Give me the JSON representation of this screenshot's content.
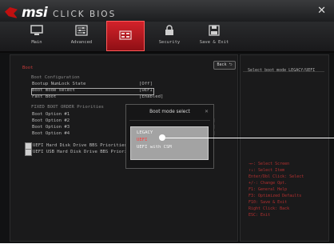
{
  "brand": {
    "name": "msi",
    "product": "CLICK BIOS"
  },
  "window": {
    "close": "✕"
  },
  "nav": {
    "tabs": [
      {
        "label": "Main",
        "icon": "monitor-icon"
      },
      {
        "label": "Advanced",
        "icon": "sliders-icon"
      },
      {
        "label": "",
        "icon": "chip-icon",
        "active": true
      },
      {
        "label": "Security",
        "icon": "lock-icon"
      },
      {
        "label": "Save & Exit",
        "icon": "save-icon"
      }
    ]
  },
  "main": {
    "section": "Boot",
    "back_label": "Back",
    "config_heading": "Boot Configuration",
    "rows": [
      {
        "label": "Bootup NumLock State",
        "value": "[Off]"
      },
      {
        "label": "Boot mode select",
        "value": "[UEFI]"
      },
      {
        "label": "Fast Boot",
        "value": "[Enabled]"
      }
    ],
    "fixed_heading": "FIXED BOOT ORDER Priorities",
    "boot_options": [
      {
        "label": "Boot Option #1",
        "value": "]"
      },
      {
        "label": "Boot Option #2",
        "value": "]"
      },
      {
        "label": "Boot Option #3",
        "value": "]"
      },
      {
        "label": "Boot Option #4",
        "value": "]"
      }
    ],
    "links": [
      "UEFI Hard Disk Drive BBS Priorities",
      "UEFI USB Hard Disk Drive BBS Priorit"
    ]
  },
  "dialog": {
    "title": "Boot mode select",
    "close": "✕",
    "options": [
      "LEGACY",
      "UEFI",
      "UEFI with CSM"
    ],
    "selected": "UEFI"
  },
  "help": {
    "text": "Select boot mode LEGACY/UEFI",
    "keys": [
      "→←: Select Screen",
      "↑↓: Select Item",
      "Enter/Dbl Click: Select",
      "+/-: Change Opt.",
      "F1: General Help",
      "F3: Optimized Defaults",
      "F10: Save & Exit",
      "Right Click: Back",
      "ESC: Exit"
    ]
  },
  "colors": {
    "accent": "#d3222a",
    "selected_option": "#ff3b3b",
    "section_heading": "#c43a3a"
  }
}
